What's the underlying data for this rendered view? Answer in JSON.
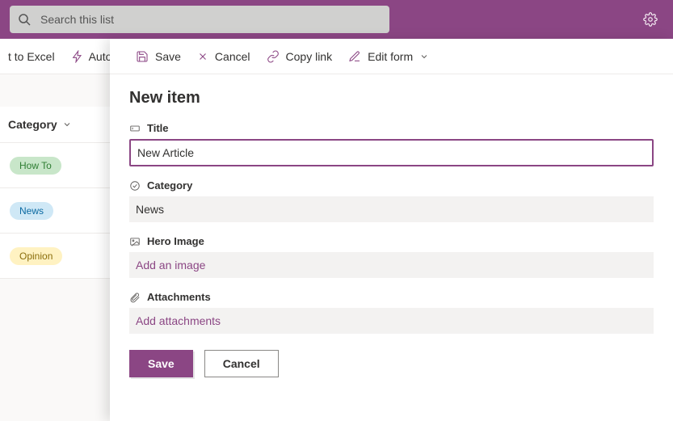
{
  "search": {
    "placeholder": "Search this list"
  },
  "behind_toolbar": {
    "excel": "t to Excel",
    "auto": "Auto"
  },
  "list": {
    "col_label": "Category",
    "rows": [
      {
        "label": "How To",
        "bg": "#c8e6c9",
        "fg": "#2e7d32"
      },
      {
        "label": "News",
        "bg": "#cfe8f6",
        "fg": "#0b6aa2"
      },
      {
        "label": "Opinion",
        "bg": "#fff2c2",
        "fg": "#8a6d0b"
      }
    ]
  },
  "panel": {
    "toolbar": {
      "save": "Save",
      "cancel": "Cancel",
      "copy": "Copy link",
      "edit": "Edit form"
    },
    "title": "New item",
    "fields": {
      "title_label": "Title",
      "title_value": "New Article",
      "category_label": "Category",
      "category_value": "News",
      "hero_label": "Hero Image",
      "hero_action": "Add an image",
      "attach_label": "Attachments",
      "attach_action": "Add attachments"
    },
    "buttons": {
      "save": "Save",
      "cancel": "Cancel"
    }
  }
}
